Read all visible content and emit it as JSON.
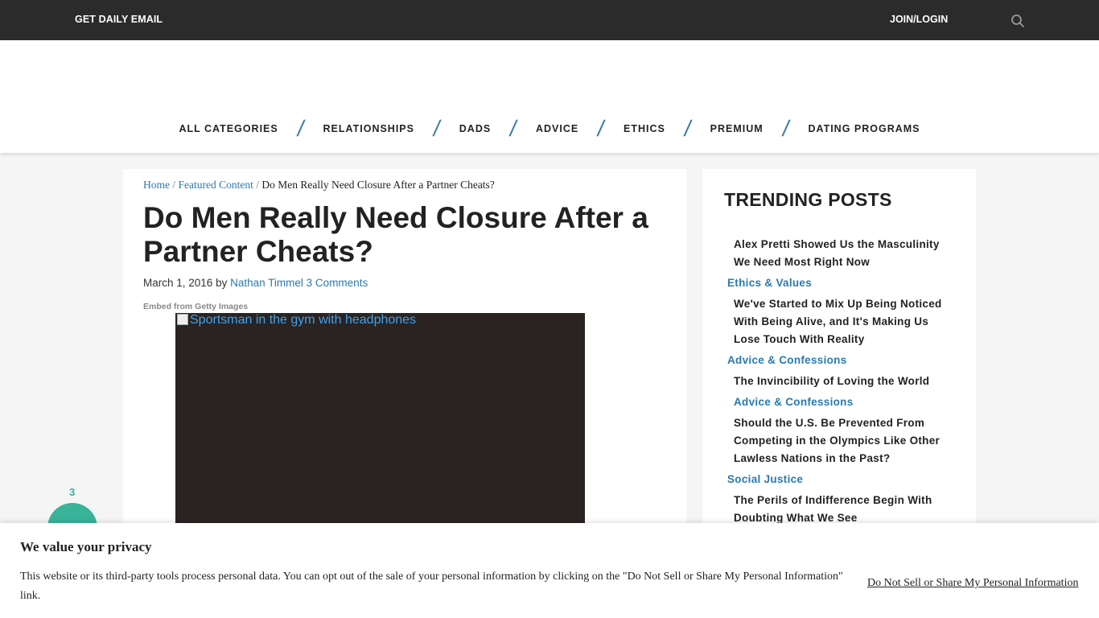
{
  "topbar": {
    "daily_email": "GET DAILY EMAIL",
    "join_login": "JOIN/LOGIN"
  },
  "nav": {
    "items": [
      "ALL CATEGORIES",
      "RELATIONSHIPS",
      "DADS",
      "ADVICE",
      "ETHICS",
      "PREMIUM",
      "DATING PROGRAMS"
    ],
    "separator": "/"
  },
  "breadcrumb": {
    "home": "Home",
    "sep": "/",
    "featured": "Featured Content",
    "current": "Do Men Really Need Closure After a Partner Cheats?"
  },
  "article": {
    "title": "Do Men Really Need Closure After a Partner Cheats?",
    "date": "March 1, 2016",
    "by": "by",
    "author": "Nathan Timmel",
    "comments": "3 Comments",
    "embed_label": "Embed from Getty Images",
    "image_alt": "Sportsman in the gym with headphones"
  },
  "sidebar": {
    "heading": "TRENDING POSTS",
    "posts": [
      {
        "title": "Alex Pretti Showed Us the Masculinity We Need Most Right Now",
        "category": "Ethics & Values"
      },
      {
        "title": "We've Started to Mix Up Being Noticed With Being Alive, and It's Making Us Lose Touch With Reality",
        "category": "Advice & Confessions"
      },
      {
        "title": "The Invincibility of Loving the World",
        "category": "Advice & Confessions"
      },
      {
        "title": "Should the U.S. Be Prevented From Competing in the Olympics Like Other Lawless Nations in the Past?",
        "category": "Social Justice"
      },
      {
        "title": "The Perils of Indifference Begin With Doubting What We See",
        "category": ""
      }
    ]
  },
  "share": {
    "count": "3"
  },
  "privacy": {
    "title": "We value your privacy",
    "body": "This website or its third-party tools process personal data. You can opt out of the sale of your personal information by clicking on the \"Do Not Sell or Share My Personal Information\" link.",
    "link": "Do Not Sell or Share My Personal Information"
  },
  "colors": {
    "topbar": "#2b2b2b",
    "accent": "#2a7ab0",
    "share": "#39b39a"
  }
}
